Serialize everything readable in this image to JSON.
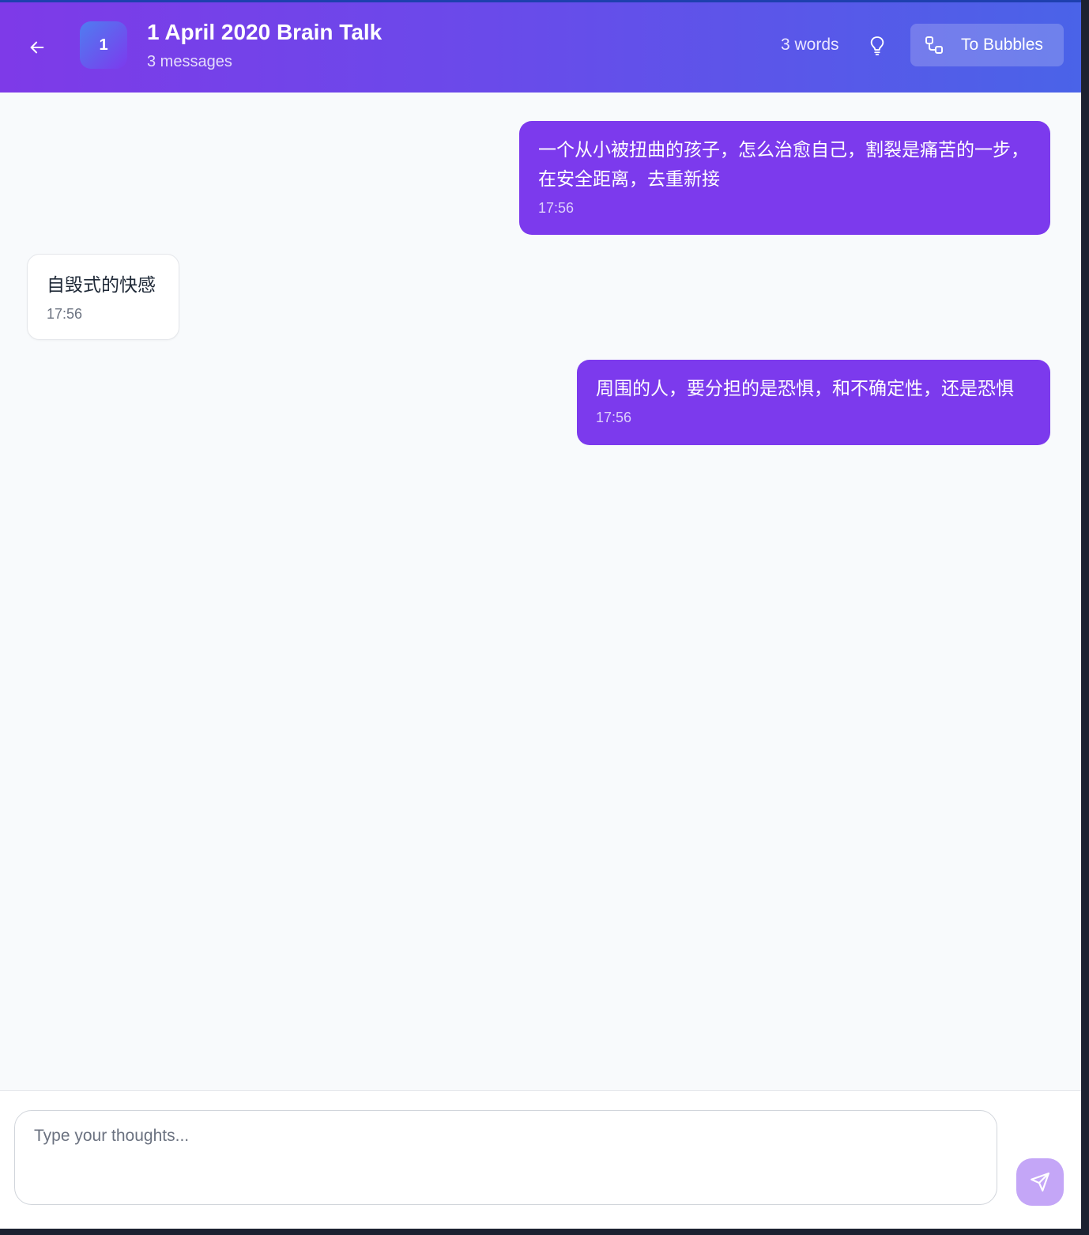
{
  "header": {
    "avatar_label": "1",
    "title": "1 April 2020 Brain Talk",
    "subtitle": "3 messages",
    "word_count": "3 words",
    "to_bubbles_label": "To Bubbles",
    "back_icon": "arrow-left-icon",
    "bulb_icon": "lightbulb-icon",
    "bubbles_icon": "bubbles-connect-icon"
  },
  "messages": [
    {
      "role": "user",
      "text": "一个从小被扭曲的孩子，怎么治愈自己，割裂是痛苦的一步，在安全距离，去重新接",
      "time": "17:56"
    },
    {
      "role": "assistant",
      "text": "自毁式的快感",
      "time": "17:56"
    },
    {
      "role": "user",
      "text": "周围的人，要分担的是恐惧，和不确定性，还是恐惧",
      "time": "17:56"
    }
  ],
  "composer": {
    "placeholder": "Type your thoughts...",
    "value": "",
    "send_icon": "send-icon"
  },
  "colors": {
    "header_gradient_start": "#7e3ae8",
    "header_gradient_end": "#4a63e8",
    "user_bubble": "#7c3aed",
    "ai_bubble": "#ffffff",
    "send_button": "#c4a6f7",
    "chat_background": "#f8fafc"
  }
}
